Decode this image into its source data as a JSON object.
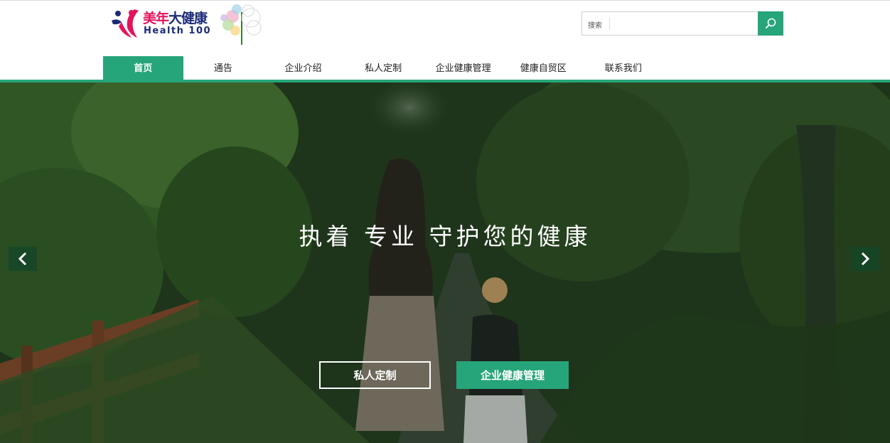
{
  "brand": {
    "name_cn_part1": "美年",
    "name_cn_part2": "大健康",
    "name_en": "Health 100",
    "logo_icon": "brand-mark-icon",
    "tree_icon": "tree-icon"
  },
  "search": {
    "label": "搜索",
    "placeholder": "",
    "button_icon": "search-icon"
  },
  "nav": {
    "items": [
      {
        "label": "首页",
        "active": true
      },
      {
        "label": "通告",
        "active": false
      },
      {
        "label": "企业介绍",
        "active": false
      },
      {
        "label": "私人定制",
        "active": false
      },
      {
        "label": "企业健康管理",
        "active": false
      },
      {
        "label": "健康自贸区",
        "active": false
      },
      {
        "label": "联系我们",
        "active": false
      }
    ]
  },
  "hero": {
    "slogan": "执着 专业 守护您的健康",
    "prev_icon": "chevron-left-icon",
    "next_icon": "chevron-right-icon",
    "cta_primary_outline": "私人定制",
    "cta_primary_solid": "企业健康管理"
  },
  "colors": {
    "accent": "#27a57a",
    "brand_pink": "#e4145c",
    "brand_navy": "#1b2a78"
  }
}
